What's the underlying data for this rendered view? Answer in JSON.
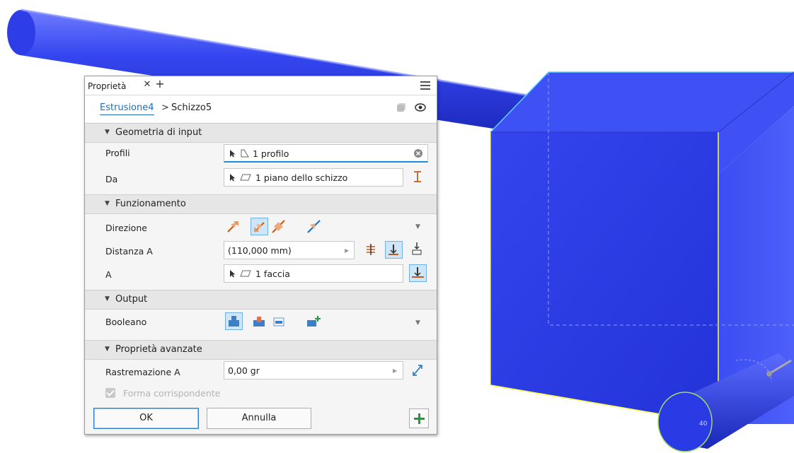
{
  "scene": {
    "colors": {
      "body": "#2f3fe8",
      "cube_front": "#2d3ce6",
      "cube_top": "#4154f4",
      "highlight": "#ffff40"
    }
  },
  "panel": {
    "tab_label": "Proprietà",
    "close_glyph": "✕",
    "add_glyph": "+",
    "breadcrumb": {
      "feature": "Estrusione4",
      "separator": ">",
      "sketch": "Schizzo5"
    },
    "sections": {
      "input": "Geometria di input",
      "behavior": "Funzionamento",
      "output": "Output",
      "advanced": "Proprietà avanzate"
    },
    "rows": {
      "profiles": {
        "label": "Profili",
        "value": "1 profilo"
      },
      "from": {
        "label": "Da",
        "value": "1 piano dello schizzo"
      },
      "direction": {
        "label": "Direzione"
      },
      "distance_a": {
        "label": "Distanza A",
        "value": "(110,000 mm)"
      },
      "to": {
        "label": "A",
        "value": "1 faccia"
      },
      "boolean": {
        "label": "Booleano"
      },
      "taper": {
        "label": "Rastremazione A",
        "value": "0,00 gr"
      },
      "match_shape": {
        "label": "Forma corrispondente",
        "checked": true
      }
    },
    "buttons": {
      "ok": "OK",
      "cancel": "Annulla"
    },
    "accent": "#1a6ec0",
    "icons": [
      "arrow-pointer-icon",
      "profile-icon",
      "plane-icon",
      "clear-icon",
      "menu-icon",
      "pin-icon",
      "eye-icon",
      "flip-icon",
      "direction-default-icon",
      "direction-flipped-icon",
      "direction-symmetric-icon",
      "direction-asymmetric-icon",
      "extent-distance-icon",
      "extent-to-icon",
      "extent-to-next-icon",
      "join-icon",
      "cut-icon",
      "intersect-icon",
      "new-solid-icon",
      "taper-flip-icon",
      "plus-icon"
    ]
  },
  "viewport": {
    "dimension_text": "40"
  }
}
